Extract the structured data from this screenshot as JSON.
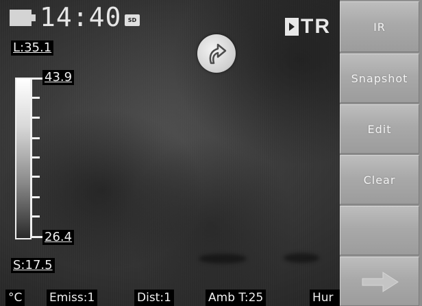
{
  "status_bar": {
    "battery_icon": "battery-icon",
    "time": "14:40",
    "sd_card_label": "SD",
    "brand_text": "TR"
  },
  "readouts": {
    "large_value": "L:35.1",
    "small_value": "S:17.5"
  },
  "color_scale": {
    "max": "43.9",
    "min": "26.4"
  },
  "rotate_indicator_icon": "rotate-arrow-icon",
  "parameters": {
    "unit": "°C",
    "emissivity": "Emiss:1",
    "distance": "Dist:1",
    "ambient_temp": "Amb T:25",
    "humidity": "Hur"
  },
  "menu": {
    "items": [
      {
        "label": "IR"
      },
      {
        "label": "Snapshot"
      },
      {
        "label": "Edit"
      },
      {
        "label": "Clear"
      },
      {
        "label": ""
      },
      {
        "label": "",
        "icon": "arrow-right-icon"
      }
    ]
  },
  "colors": {
    "menu_button": "#a9a9a9",
    "background": "#2b2b2b",
    "text": "#f0f0f0"
  }
}
